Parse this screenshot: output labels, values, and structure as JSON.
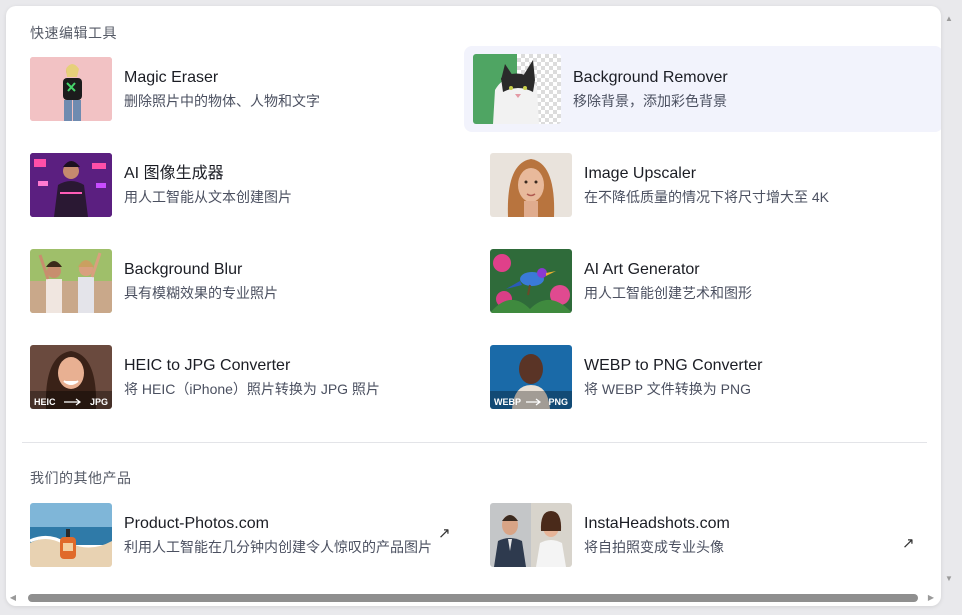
{
  "quick_tools": {
    "heading": "快速编辑工具",
    "items": [
      {
        "title": "Magic Eraser",
        "subtitle": "删除照片中的物体、人物和文字",
        "icon": "magic-eraser-thumbnail"
      },
      {
        "title": "Background Remover",
        "subtitle": "移除背景，添加彩色背景",
        "icon": "background-remover-thumbnail"
      },
      {
        "title": "AI 图像生成器",
        "subtitle": "用人工智能从文本创建图片",
        "icon": "ai-image-generator-thumbnail"
      },
      {
        "title": "Image Upscaler",
        "subtitle": "在不降低质量的情况下将尺寸增大至 4K",
        "icon": "image-upscaler-thumbnail"
      },
      {
        "title": "Background Blur",
        "subtitle": "具有模糊效果的专业照片",
        "icon": "background-blur-thumbnail"
      },
      {
        "title": "AI Art Generator",
        "subtitle": "用人工智能创建艺术和图形",
        "icon": "ai-art-generator-thumbnail"
      },
      {
        "title": "HEIC to JPG Converter",
        "subtitle": "将 HEIC（iPhone）照片转换为 JPG 照片",
        "icon": "heic-to-jpg-thumbnail",
        "thumb_from": "HEIC",
        "thumb_to": "JPG"
      },
      {
        "title": "WEBP to PNG Converter",
        "subtitle": "将 WEBP 文件转换为 PNG",
        "icon": "webp-to-png-thumbnail",
        "thumb_from": "WEBP",
        "thumb_to": "PNG"
      }
    ]
  },
  "other_products": {
    "heading": "我们的其他产品",
    "items": [
      {
        "title": "Product-Photos.com",
        "subtitle": "利用人工智能在几分钟内创建令人惊叹的产品图片",
        "icon": "external-link-icon"
      },
      {
        "title": "InstaHeadshots.com",
        "subtitle": "将自拍照变成专业头像",
        "icon": "external-link-icon"
      }
    ]
  },
  "colors": {
    "active_bg": "#f2f3fc",
    "title_text": "#1b1d24",
    "subtitle_text": "#4b5060"
  }
}
